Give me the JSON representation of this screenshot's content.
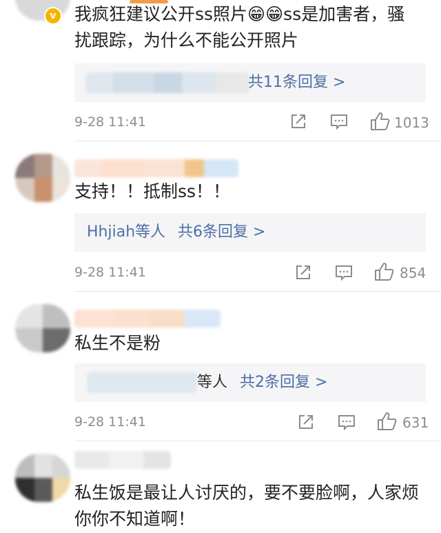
{
  "comments": [
    {
      "text": "我疯狂建议公开ss照片😁😁ss是加害者，骚扰跟踪，为什么不能公开照片",
      "reply_names": "",
      "reply_count": "共11条回复 >",
      "time": "9-28 11:41",
      "likes": "1013"
    },
    {
      "text": "支持！！抵制ss！！",
      "reply_names": "Hhjiah等人",
      "reply_count": "共6条回复 >",
      "time": "9-28 11:41",
      "likes": "854"
    },
    {
      "text": "私生不是粉",
      "reply_names": "等人",
      "reply_count": "共2条回复 >",
      "time": "9-28 11:41",
      "likes": "631"
    },
    {
      "text": "私生饭是最让人讨厌的，要不要脸啊，人家烦你你不知道啊！",
      "reply_names": "",
      "reply_count": "",
      "time": "",
      "likes": ""
    }
  ],
  "icons": {
    "share": "share-icon",
    "comment": "comment-icon",
    "like": "thumbs-up-icon",
    "verified": "verified-badge-icon"
  },
  "colors": {
    "accent": "#f39a4c",
    "link": "#4e6ea5",
    "meta": "#8c8c8c"
  }
}
